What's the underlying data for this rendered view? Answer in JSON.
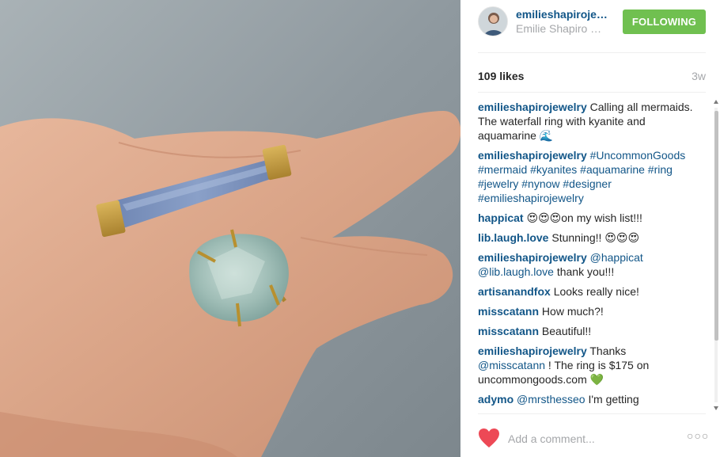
{
  "post": {
    "username": "emilieshapiroje…",
    "full_name": "Emilie Shapiro …",
    "follow_label": "FOLLOWING",
    "likes": "109 likes",
    "time_ago": "3w"
  },
  "comments": [
    {
      "author": "emilieshapirojewelry",
      "text": " Calling all mermaids. The waterfall ring with kyanite and aquamarine 🌊"
    },
    {
      "author": "emilieshapirojewelry",
      "text": "",
      "links": "#UncommonGoods #mermaid #kyanites #aquamarine #ring #jewelry #nynow #designer #emilieshapirojewelry"
    },
    {
      "author": "happicat",
      "text": " 😍😍😍on my wish list!!!"
    },
    {
      "author": "lib.laugh.love",
      "text": " Stunning!! 😍😍😍"
    },
    {
      "author": "emilieshapirojewelry",
      "links": "@happicat @lib.laugh.love",
      "text": " thank you!!!"
    },
    {
      "author": "artisanandfox",
      "text": " Looks really nice!"
    },
    {
      "author": "misscatann",
      "text": " How much?!"
    },
    {
      "author": "misscatann",
      "text": " Beautiful!!"
    },
    {
      "author": "emilieshapirojewelry",
      "text": " Thanks",
      "links": "@misscatann",
      "text2": " ! The ring is $175 on uncommongoods.com 💚"
    },
    {
      "author": "adymo",
      "links": "@mrsthesseo",
      "text": " I'm getting"
    }
  ],
  "footer": {
    "add_comment_placeholder": "Add a comment...",
    "more_label": "○○○"
  },
  "icons": {
    "heart": "heart-icon",
    "more": "more-options-icon"
  },
  "colors": {
    "link": "#125688",
    "follow_green": "#70c050",
    "heart_red": "#ed4956",
    "muted": "#a5a7aa"
  }
}
